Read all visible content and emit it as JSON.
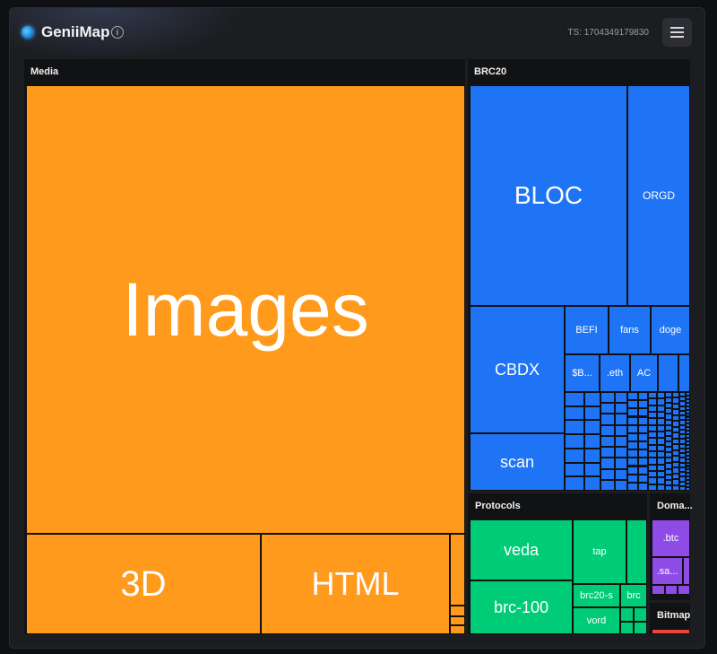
{
  "header": {
    "title": "GeniiMap",
    "timestamp": "TS: 1704349179830",
    "info_icon": "info-icon",
    "menu_icon": "list-icon"
  },
  "colors": {
    "media": "#ff9a1c",
    "brc20": "#1e74f5",
    "protocols": "#00cc78",
    "domains": "#8e4be6",
    "bitmap": "#e9453c"
  },
  "groups": {
    "media": {
      "title": "Media",
      "tiles": [
        "Images",
        "3D",
        "HTML"
      ]
    },
    "brc20": {
      "title": "BRC20",
      "tiles": [
        "BLOC",
        "ORGD",
        "CBDX",
        "BEFI",
        "fans",
        "doge",
        "$B...",
        ".eth",
        "AC",
        "scan"
      ]
    },
    "protocols": {
      "title": "Protocols",
      "tiles": [
        "veda",
        "tap",
        "brc-100",
        "brc20-s",
        "brc",
        "vord"
      ]
    },
    "domains": {
      "title": "Doma...",
      "tiles": [
        ".btc",
        ".sa..."
      ]
    },
    "bitmap": {
      "title": "Bitmap"
    }
  }
}
